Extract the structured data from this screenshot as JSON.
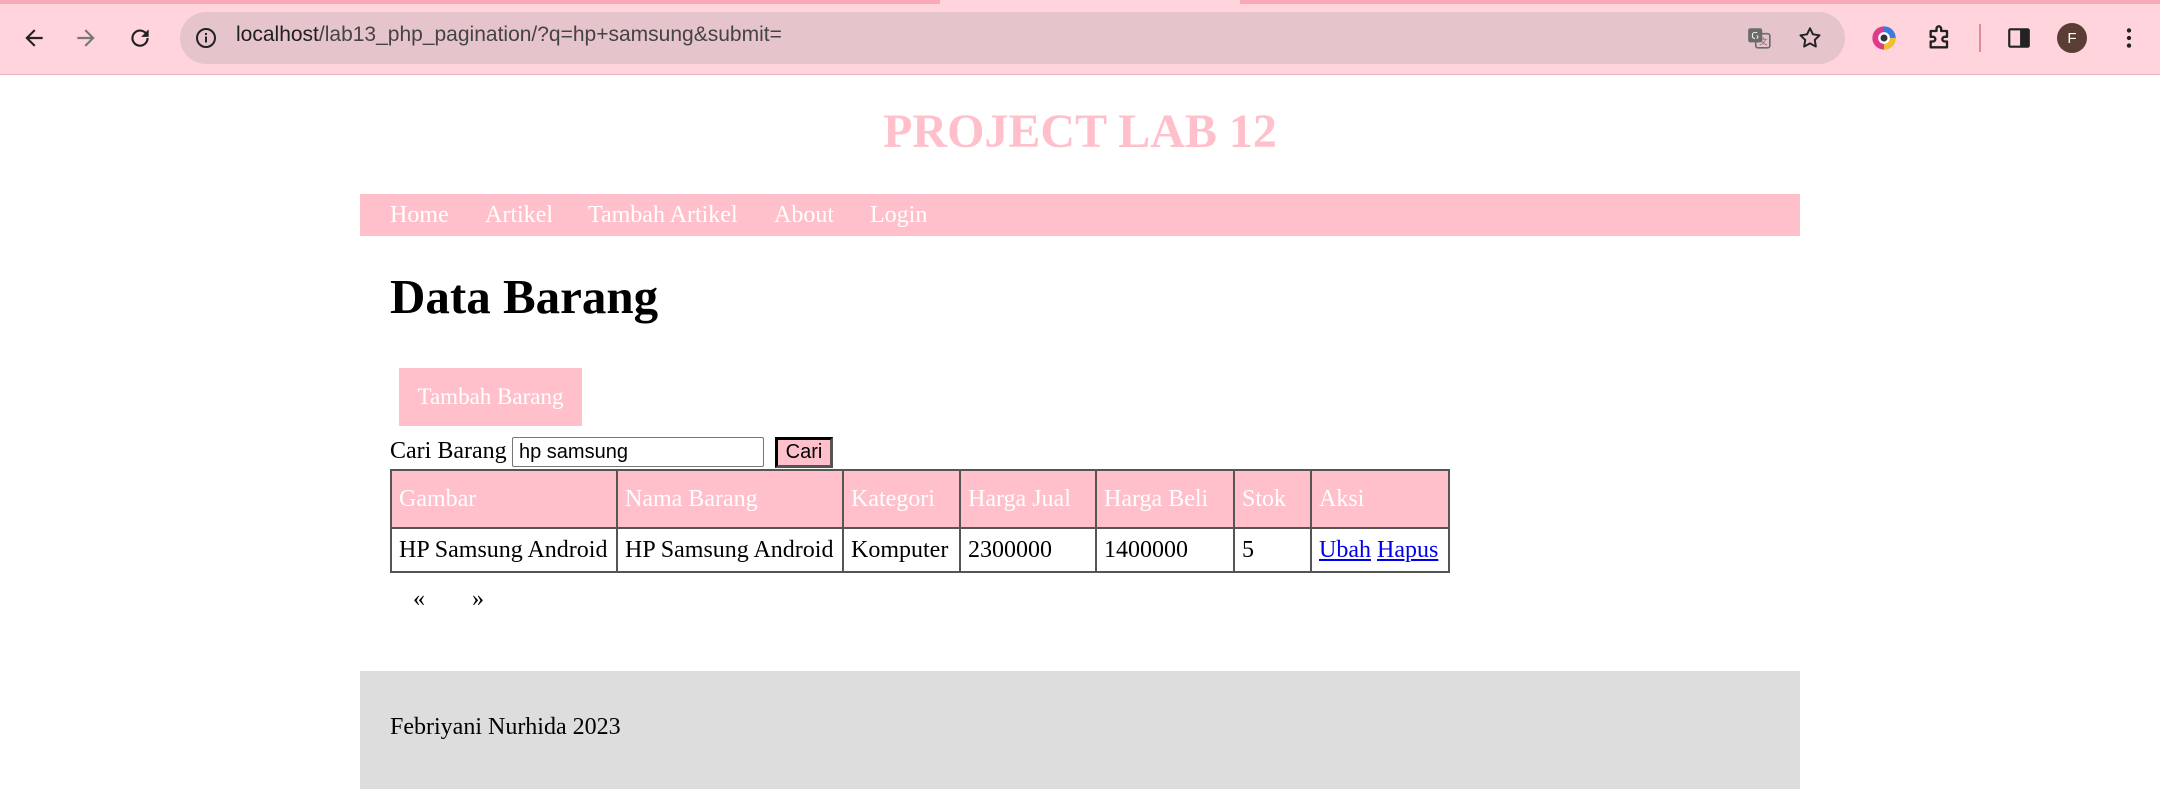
{
  "browser": {
    "url_host": "localhost",
    "url_path": "/lab13_php_pagination/?q=hp+samsung&submit=",
    "profile_initial": "F",
    "icons": [
      "back-icon",
      "forward-icon",
      "reload-icon",
      "site-info-icon",
      "translate-icon",
      "bookmark-star-icon",
      "color-extension-icon",
      "extensions-puzzle-icon",
      "side-panel-icon",
      "kebab-menu-icon"
    ]
  },
  "site": {
    "title": "PROJECT LAB 12",
    "nav": [
      "Home",
      "Artikel",
      "Tambah Artikel",
      "About",
      "Login"
    ]
  },
  "main": {
    "heading": "Data Barang",
    "add_button": "Tambah Barang",
    "search_label": "Cari Barang",
    "search_value": "hp samsung",
    "search_button": "Cari"
  },
  "table": {
    "headers": [
      "Gambar",
      "Nama Barang",
      "Kategori",
      "Harga Jual",
      "Harga Beli",
      "Stok",
      "Aksi"
    ],
    "rows": [
      {
        "gambar": "HP Samsung Android",
        "nama": "HP Samsung Android",
        "kategori": "Komputer",
        "harga_jual": "2300000",
        "harga_beli": "1400000",
        "stok": "5",
        "edit": "Ubah",
        "delete": "Hapus"
      }
    ]
  },
  "pagination": {
    "prev": "«",
    "next": "»"
  },
  "footer": {
    "text": "Febriyani Nurhida 2023"
  },
  "colors": {
    "accent": "#ffc0cb",
    "chrome": "#ffd4dd",
    "omnibox": "#e6c4cb",
    "footer": "#dddddd",
    "link": "#0000ee"
  }
}
